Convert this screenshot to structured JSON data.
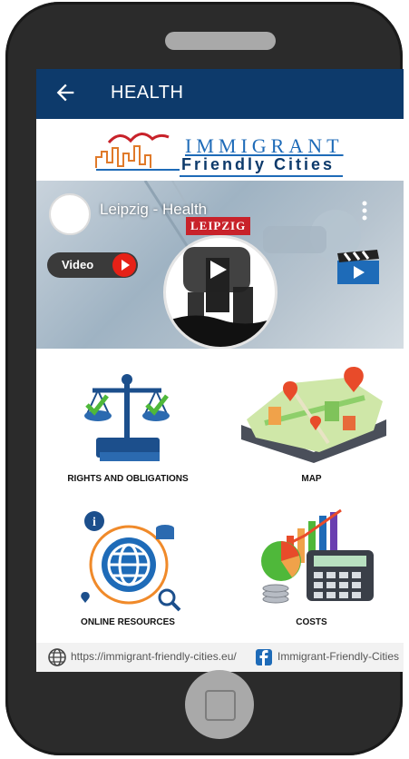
{
  "header": {
    "title": "HEALTH"
  },
  "logo": {
    "line1": "IMMIGRANT",
    "line2": "Friendly Cities"
  },
  "video": {
    "title": "Leipzig - Health",
    "badge": "LEIPZIG",
    "chip_label": "Video"
  },
  "grid": [
    {
      "label": "RIGHTS AND OBLIGATIONS"
    },
    {
      "label": "MAP"
    },
    {
      "label": "ONLINE RESOURCES"
    },
    {
      "label": "COSTS"
    }
  ],
  "footer": {
    "url": "https://immigrant-friendly-cities.eu/",
    "facebook": "Immigrant-Friendly-Cities"
  },
  "colors": {
    "appbar": "#0d3a6b",
    "accent_blue": "#1e6bb8",
    "youtube_red": "#e62117"
  }
}
